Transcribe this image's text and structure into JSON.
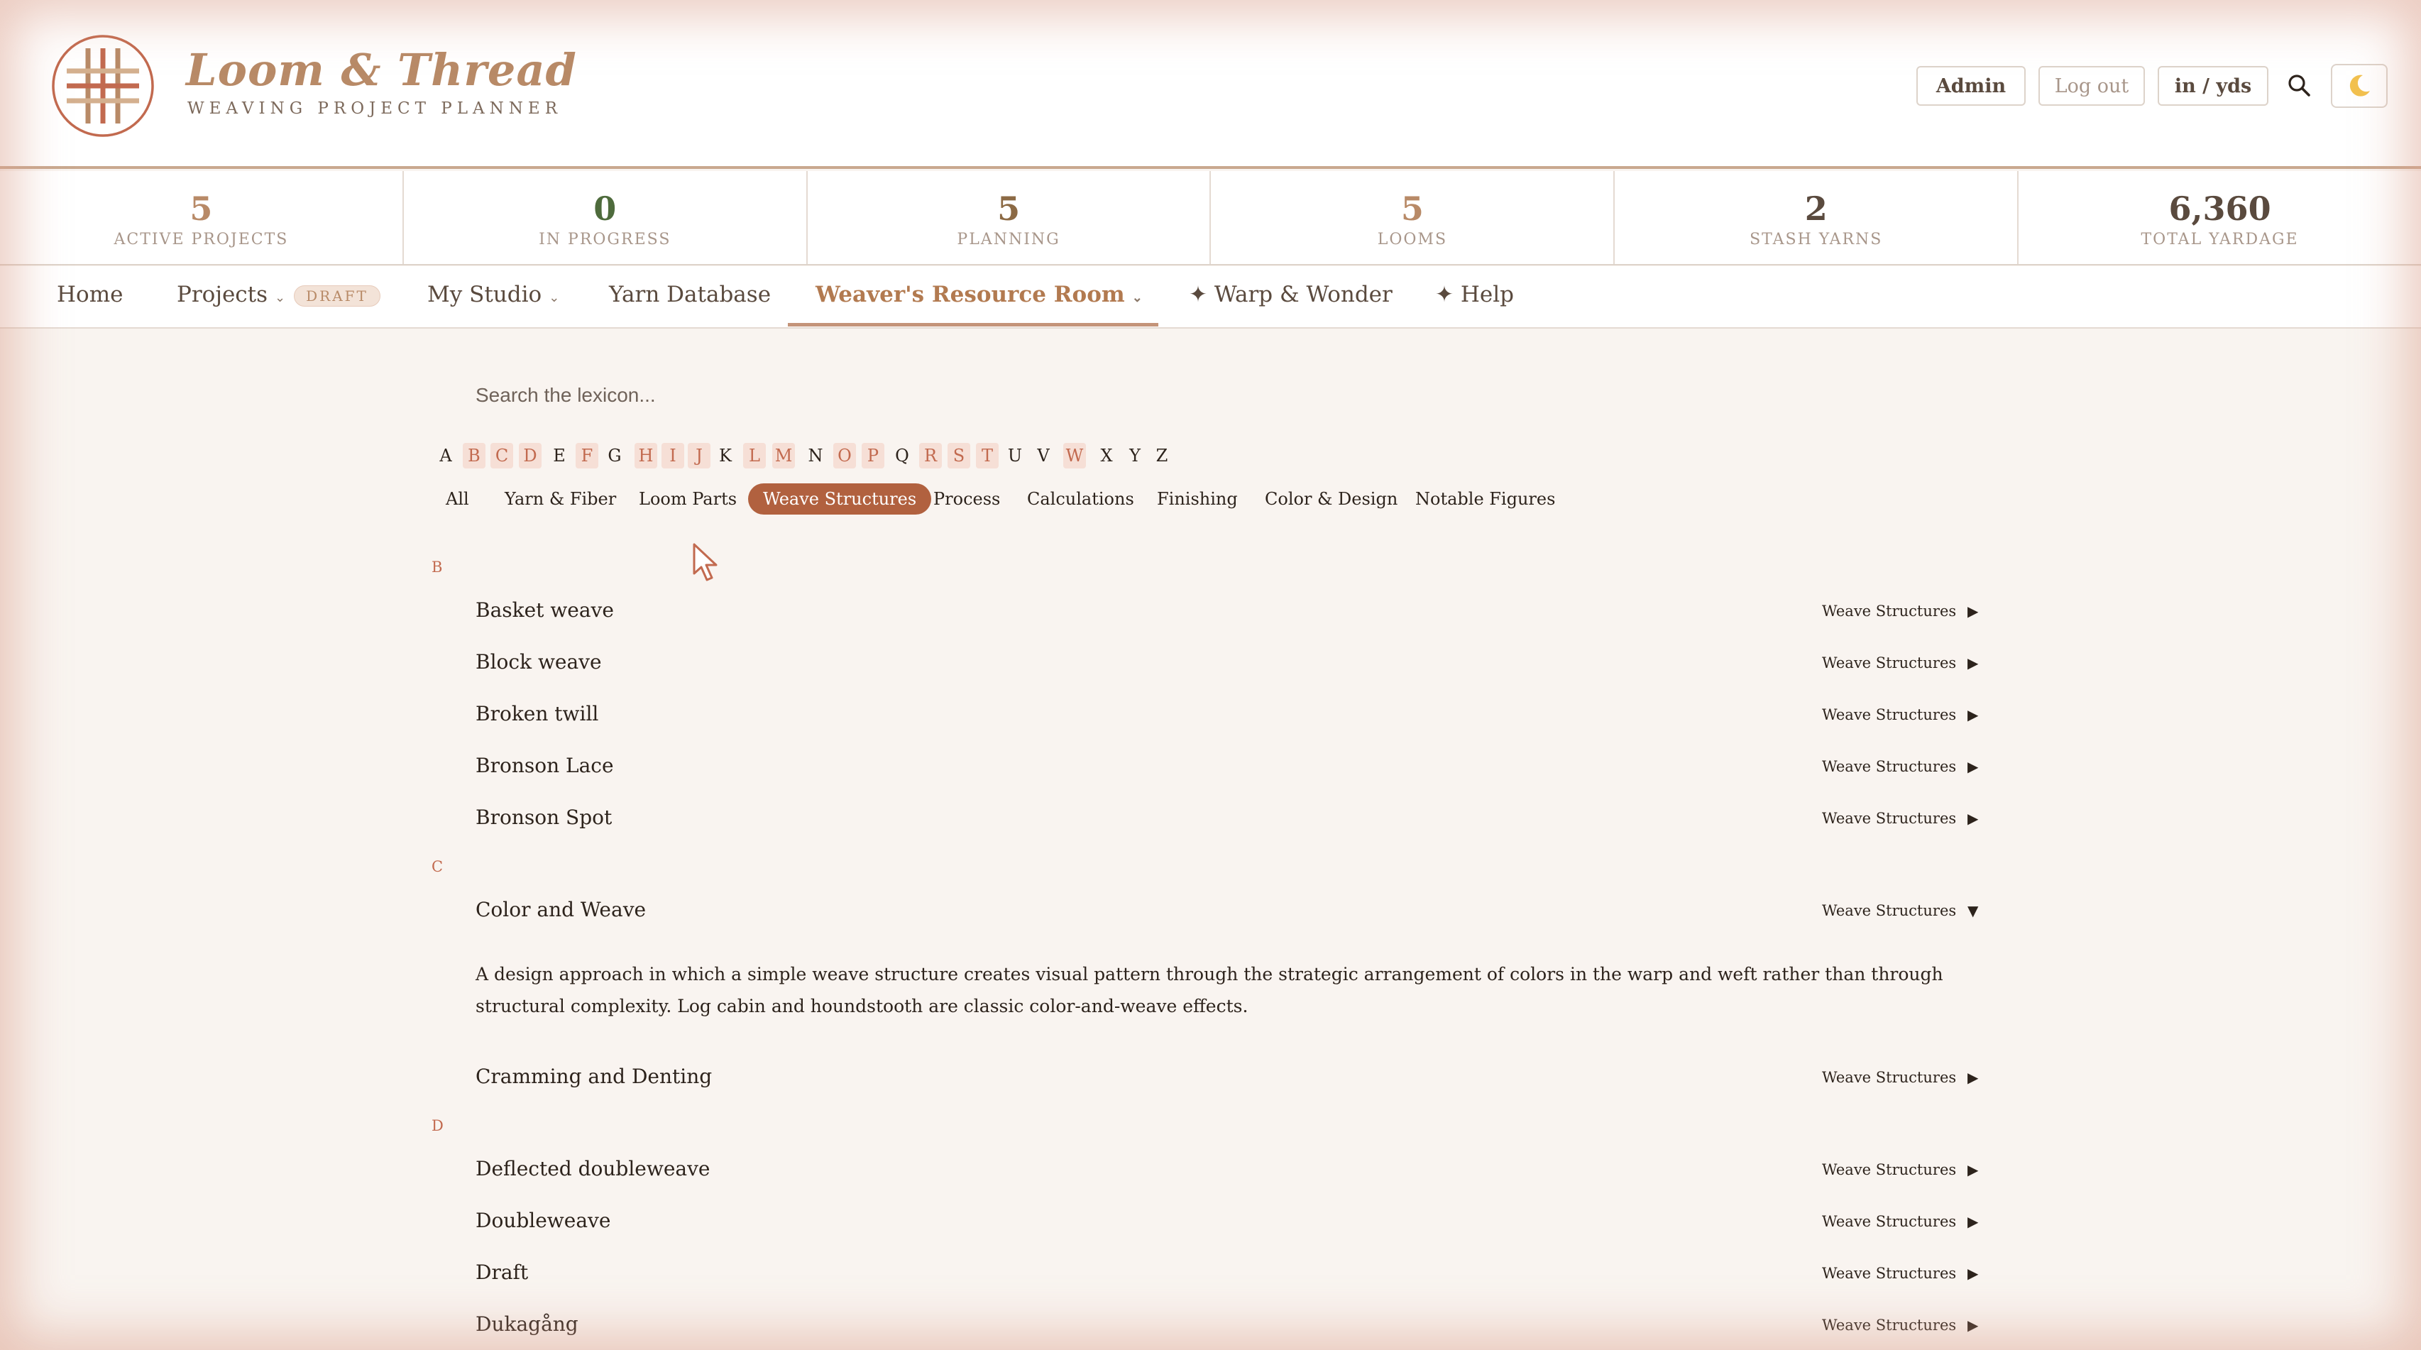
{
  "brand": {
    "title": "Loom & Thread",
    "subtitle": "WEAVING PROJECT PLANNER"
  },
  "header": {
    "admin": "Admin",
    "logout": "Log out",
    "units": "in / yds"
  },
  "stats": [
    {
      "value": "5",
      "label": "ACTIVE PROJECTS"
    },
    {
      "value": "0",
      "label": "IN PROGRESS"
    },
    {
      "value": "5",
      "label": "PLANNING"
    },
    {
      "value": "5",
      "label": "LOOMS"
    },
    {
      "value": "2",
      "label": "STASH YARNS"
    },
    {
      "value": "6,360",
      "label": "TOTAL YARDAGE"
    }
  ],
  "nav": {
    "home": "Home",
    "projects": "Projects",
    "draft": "DRAFT",
    "studio": "My Studio",
    "yarn": "Yarn Database",
    "resource": "Weaver's Resource Room",
    "warp": "✦ Warp & Wonder",
    "help": "✦ Help"
  },
  "search": {
    "placeholder": "Search the lexicon..."
  },
  "letters": [
    "A",
    "B",
    "C",
    "D",
    "E",
    "F",
    "G",
    "H",
    "I",
    "J",
    "K",
    "L",
    "M",
    "N",
    "O",
    "P",
    "Q",
    "R",
    "S",
    "T",
    "U",
    "V",
    "W",
    "X",
    "Y",
    "Z"
  ],
  "filters": [
    "All",
    "Yarn & Fiber",
    "Loom Parts",
    "Weave Structures",
    "Process",
    "Calculations",
    "Finishing",
    "Color & Design",
    "Notable Figures"
  ],
  "sections": {
    "b": "B",
    "c": "C",
    "d": "D"
  },
  "entries": [
    {
      "term": "Basket weave",
      "category": "Weave Structures",
      "arrow": "▶"
    },
    {
      "term": "Block weave",
      "category": "Weave Structures",
      "arrow": "▶"
    },
    {
      "term": "Broken twill",
      "category": "Weave Structures",
      "arrow": "▶"
    },
    {
      "term": "Bronson Lace",
      "category": "Weave Structures",
      "arrow": "▶"
    },
    {
      "term": "Bronson Spot",
      "category": "Weave Structures",
      "arrow": "▶"
    },
    {
      "term": "Color and Weave",
      "category": "Weave Structures",
      "arrow": "▼"
    },
    {
      "term": "Cramming and Denting",
      "category": "Weave Structures",
      "arrow": "▶"
    },
    {
      "term": "Deflected doubleweave",
      "category": "Weave Structures",
      "arrow": "▶"
    },
    {
      "term": "Doubleweave",
      "category": "Weave Structures",
      "arrow": "▶"
    },
    {
      "term": "Draft",
      "category": "Weave Structures",
      "arrow": "▶"
    },
    {
      "term": "Dukagång",
      "category": "Weave Structures",
      "arrow": "▶"
    }
  ],
  "definition": "A design approach in which a simple weave structure creates visual pattern through the strategic arrangement of colors in the warp and weft rather than through structural complexity. Log cabin and houndstooth are classic color-and-weave effects."
}
